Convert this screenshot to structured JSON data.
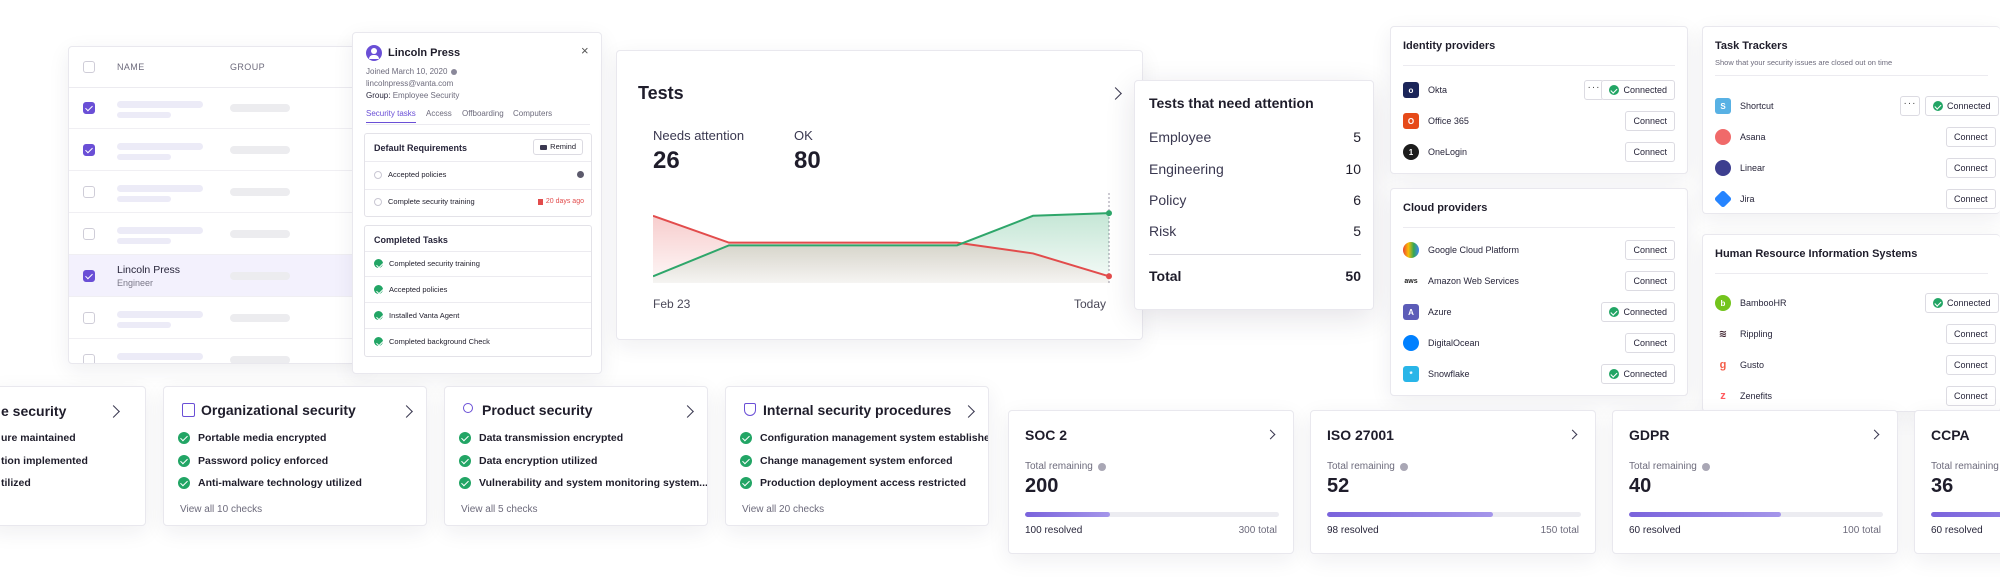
{
  "people_table": {
    "headers": [
      "NAME",
      "GROUP"
    ],
    "rows": [
      {
        "checked": true
      },
      {
        "checked": true
      },
      {
        "checked": false
      },
      {
        "checked": false
      },
      {
        "checked": true,
        "name": "Lincoln Press",
        "role": "Engineer"
      },
      {
        "checked": false
      },
      {
        "checked": false
      }
    ]
  },
  "profile": {
    "name": "Lincoln Press",
    "joined": "Joined March 10, 2020",
    "email": "lincolnpress@vanta.com",
    "group_label": "Group:",
    "group_value": "Employee Security",
    "tabs": [
      "Security tasks",
      "Access",
      "Offboarding",
      "Computers"
    ],
    "default_requirements": {
      "title": "Default Requirements",
      "remind_label": "Remind",
      "items": [
        {
          "label": "Accepted policies",
          "status": ""
        },
        {
          "label": "Complete security training",
          "status": "20 days ago"
        }
      ]
    },
    "completed_tasks": {
      "title": "Completed Tasks",
      "items": [
        "Completed security training",
        "Accepted policies",
        "Installed Vanta Agent",
        "Completed background Check"
      ]
    }
  },
  "tests": {
    "title": "Tests",
    "needs_attention_label": "Needs attention",
    "needs_attention_value": "26",
    "ok_label": "OK",
    "ok_value": "80",
    "x_start": "Feb 23",
    "x_end": "Today",
    "chart_data": {
      "type": "area",
      "x": [
        "Feb 23",
        "",
        "",
        "",
        "",
        "",
        "Today"
      ],
      "series": [
        {
          "name": "Needs attention",
          "color": "#e24c4c",
          "values": [
            50,
            30,
            30,
            30,
            30,
            22,
            5
          ]
        },
        {
          "name": "OK",
          "color": "#2ea66a",
          "values": [
            5,
            28,
            28,
            28,
            28,
            50,
            52
          ]
        }
      ],
      "ylim": [
        0,
        100
      ],
      "grid": false
    }
  },
  "attention": {
    "title": "Tests that need attention",
    "rows": [
      {
        "label": "Employee",
        "value": "5"
      },
      {
        "label": "Engineering",
        "value": "10"
      },
      {
        "label": "Policy",
        "value": "6"
      },
      {
        "label": "Risk",
        "value": "5"
      }
    ],
    "total_label": "Total",
    "total_value": "50"
  },
  "identity_providers": {
    "title": "Identity providers",
    "items": [
      {
        "name": "Okta",
        "status": "Connected",
        "logo": "okta-logo-icon"
      },
      {
        "name": "Office 365",
        "status": "Connect",
        "logo": "office365-logo-icon"
      },
      {
        "name": "OneLogin",
        "status": "Connect",
        "logo": "onelogin-logo-icon"
      }
    ]
  },
  "cloud_providers": {
    "title": "Cloud providers",
    "items": [
      {
        "name": "Google Cloud Platform",
        "status": "Connect"
      },
      {
        "name": "Amazon Web Services",
        "status": "Connect"
      },
      {
        "name": "Azure",
        "status": "Connected"
      },
      {
        "name": "DigitalOcean",
        "status": "Connect"
      },
      {
        "name": "Snowflake",
        "status": "Connected"
      }
    ]
  },
  "task_trackers": {
    "title": "Task Trackers",
    "subtitle": "Show that your security issues are closed out on time",
    "items": [
      {
        "name": "Shortcut",
        "status": "Connected"
      },
      {
        "name": "Asana",
        "status": "Connect"
      },
      {
        "name": "Linear",
        "status": "Connect"
      },
      {
        "name": "Jira",
        "status": "Connect"
      }
    ]
  },
  "hris": {
    "title": "Human Resource Information Systems",
    "items": [
      {
        "name": "BambooHR",
        "status": "Connected"
      },
      {
        "name": "Rippling",
        "status": "Connect"
      },
      {
        "name": "Gusto",
        "status": "Connect"
      },
      {
        "name": "Zenefits",
        "status": "Connect"
      }
    ]
  },
  "security_cards": [
    {
      "title": "e security",
      "checks": [
        "ure maintained",
        "tion implemented",
        "tilized"
      ],
      "view_all": ""
    },
    {
      "title": "Organizational security",
      "checks": [
        "Portable media encrypted",
        "Password policy enforced",
        "Anti-malware technology utilized"
      ],
      "view_all": "View all 10 checks"
    },
    {
      "title": "Product security",
      "checks": [
        "Data transmission encrypted",
        "Data encryption utilized",
        "Vulnerability and system monitoring system..."
      ],
      "view_all": "View all 5 checks"
    },
    {
      "title": "Internal security procedures",
      "checks": [
        "Configuration management system established",
        "Change management system enforced",
        "Production deployment access restricted"
      ],
      "view_all": "View all 20 checks"
    }
  ],
  "frameworks": [
    {
      "name": "SOC 2",
      "remaining_label": "Total remaining",
      "remaining": "200",
      "resolved": "100 resolved",
      "total": "300 total",
      "progress": 0.333
    },
    {
      "name": "ISO 27001",
      "remaining_label": "Total remaining",
      "remaining": "52",
      "resolved": "98 resolved",
      "total": "150 total",
      "progress": 0.653
    },
    {
      "name": "GDPR",
      "remaining_label": "Total remaining",
      "remaining": "40",
      "resolved": "60 resolved",
      "total": "100 total",
      "progress": 0.6
    },
    {
      "name": "CCPA",
      "remaining_label": "Total remaining",
      "remaining": "36",
      "resolved": "60 resolved",
      "total": "",
      "progress": 0.62
    }
  ],
  "colors": {
    "accent": "#6a4fd6",
    "ok_green": "#22a565",
    "alert_red": "#e24c4c"
  }
}
